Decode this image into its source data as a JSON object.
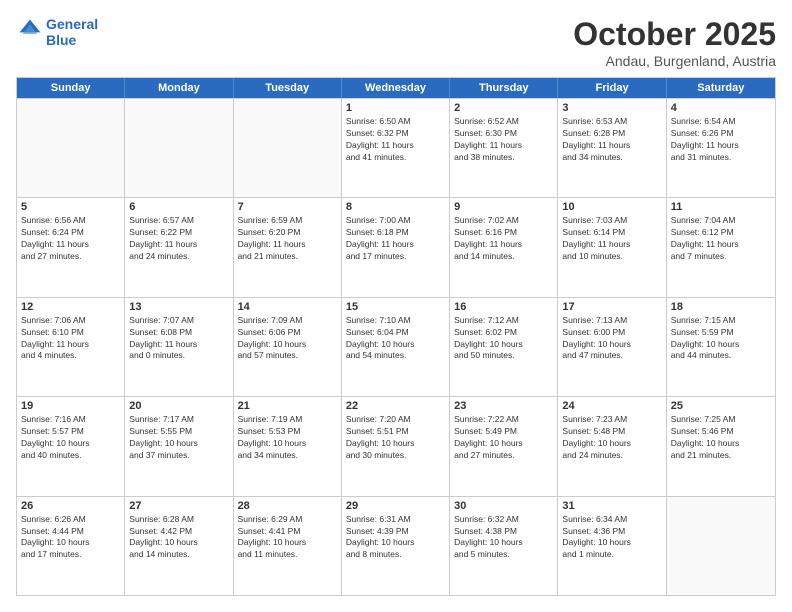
{
  "header": {
    "logo_line1": "General",
    "logo_line2": "Blue",
    "title": "October 2025",
    "subtitle": "Andau, Burgenland, Austria"
  },
  "weekdays": [
    "Sunday",
    "Monday",
    "Tuesday",
    "Wednesday",
    "Thursday",
    "Friday",
    "Saturday"
  ],
  "weeks": [
    [
      {
        "day": "",
        "info": ""
      },
      {
        "day": "",
        "info": ""
      },
      {
        "day": "",
        "info": ""
      },
      {
        "day": "1",
        "info": "Sunrise: 6:50 AM\nSunset: 6:32 PM\nDaylight: 11 hours\nand 41 minutes."
      },
      {
        "day": "2",
        "info": "Sunrise: 6:52 AM\nSunset: 6:30 PM\nDaylight: 11 hours\nand 38 minutes."
      },
      {
        "day": "3",
        "info": "Sunrise: 6:53 AM\nSunset: 6:28 PM\nDaylight: 11 hours\nand 34 minutes."
      },
      {
        "day": "4",
        "info": "Sunrise: 6:54 AM\nSunset: 6:26 PM\nDaylight: 11 hours\nand 31 minutes."
      }
    ],
    [
      {
        "day": "5",
        "info": "Sunrise: 6:56 AM\nSunset: 6:24 PM\nDaylight: 11 hours\nand 27 minutes."
      },
      {
        "day": "6",
        "info": "Sunrise: 6:57 AM\nSunset: 6:22 PM\nDaylight: 11 hours\nand 24 minutes."
      },
      {
        "day": "7",
        "info": "Sunrise: 6:59 AM\nSunset: 6:20 PM\nDaylight: 11 hours\nand 21 minutes."
      },
      {
        "day": "8",
        "info": "Sunrise: 7:00 AM\nSunset: 6:18 PM\nDaylight: 11 hours\nand 17 minutes."
      },
      {
        "day": "9",
        "info": "Sunrise: 7:02 AM\nSunset: 6:16 PM\nDaylight: 11 hours\nand 14 minutes."
      },
      {
        "day": "10",
        "info": "Sunrise: 7:03 AM\nSunset: 6:14 PM\nDaylight: 11 hours\nand 10 minutes."
      },
      {
        "day": "11",
        "info": "Sunrise: 7:04 AM\nSunset: 6:12 PM\nDaylight: 11 hours\nand 7 minutes."
      }
    ],
    [
      {
        "day": "12",
        "info": "Sunrise: 7:06 AM\nSunset: 6:10 PM\nDaylight: 11 hours\nand 4 minutes."
      },
      {
        "day": "13",
        "info": "Sunrise: 7:07 AM\nSunset: 6:08 PM\nDaylight: 11 hours\nand 0 minutes."
      },
      {
        "day": "14",
        "info": "Sunrise: 7:09 AM\nSunset: 6:06 PM\nDaylight: 10 hours\nand 57 minutes."
      },
      {
        "day": "15",
        "info": "Sunrise: 7:10 AM\nSunset: 6:04 PM\nDaylight: 10 hours\nand 54 minutes."
      },
      {
        "day": "16",
        "info": "Sunrise: 7:12 AM\nSunset: 6:02 PM\nDaylight: 10 hours\nand 50 minutes."
      },
      {
        "day": "17",
        "info": "Sunrise: 7:13 AM\nSunset: 6:00 PM\nDaylight: 10 hours\nand 47 minutes."
      },
      {
        "day": "18",
        "info": "Sunrise: 7:15 AM\nSunset: 5:59 PM\nDaylight: 10 hours\nand 44 minutes."
      }
    ],
    [
      {
        "day": "19",
        "info": "Sunrise: 7:16 AM\nSunset: 5:57 PM\nDaylight: 10 hours\nand 40 minutes."
      },
      {
        "day": "20",
        "info": "Sunrise: 7:17 AM\nSunset: 5:55 PM\nDaylight: 10 hours\nand 37 minutes."
      },
      {
        "day": "21",
        "info": "Sunrise: 7:19 AM\nSunset: 5:53 PM\nDaylight: 10 hours\nand 34 minutes."
      },
      {
        "day": "22",
        "info": "Sunrise: 7:20 AM\nSunset: 5:51 PM\nDaylight: 10 hours\nand 30 minutes."
      },
      {
        "day": "23",
        "info": "Sunrise: 7:22 AM\nSunset: 5:49 PM\nDaylight: 10 hours\nand 27 minutes."
      },
      {
        "day": "24",
        "info": "Sunrise: 7:23 AM\nSunset: 5:48 PM\nDaylight: 10 hours\nand 24 minutes."
      },
      {
        "day": "25",
        "info": "Sunrise: 7:25 AM\nSunset: 5:46 PM\nDaylight: 10 hours\nand 21 minutes."
      }
    ],
    [
      {
        "day": "26",
        "info": "Sunrise: 6:26 AM\nSunset: 4:44 PM\nDaylight: 10 hours\nand 17 minutes."
      },
      {
        "day": "27",
        "info": "Sunrise: 6:28 AM\nSunset: 4:42 PM\nDaylight: 10 hours\nand 14 minutes."
      },
      {
        "day": "28",
        "info": "Sunrise: 6:29 AM\nSunset: 4:41 PM\nDaylight: 10 hours\nand 11 minutes."
      },
      {
        "day": "29",
        "info": "Sunrise: 6:31 AM\nSunset: 4:39 PM\nDaylight: 10 hours\nand 8 minutes."
      },
      {
        "day": "30",
        "info": "Sunrise: 6:32 AM\nSunset: 4:38 PM\nDaylight: 10 hours\nand 5 minutes."
      },
      {
        "day": "31",
        "info": "Sunrise: 6:34 AM\nSunset: 4:36 PM\nDaylight: 10 hours\nand 1 minute."
      },
      {
        "day": "",
        "info": ""
      }
    ]
  ]
}
